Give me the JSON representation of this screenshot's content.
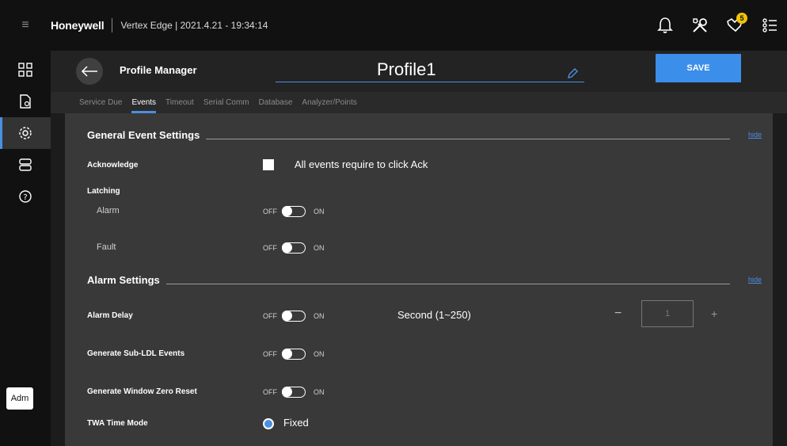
{
  "topbar": {
    "brand": "Honeywell",
    "subtitle": "Vertex Edge | 2021.4.21 - 19:34:14",
    "icons": [
      "menu-icon",
      "bell-icon",
      "tools-icon",
      "hands-icon",
      "list-icon"
    ],
    "badge_count": "5",
    "badge_color": "#f2c200"
  },
  "sidebar": {
    "items": [
      "dashboard-icon",
      "document-icon",
      "settings-icon",
      "storage-icon",
      "help-icon"
    ],
    "active": "settings-icon",
    "avatar_label": "Adm"
  },
  "header": {
    "title": "Profile Manager",
    "profile_name": "Profile1",
    "save_label": "SAVE",
    "accent": "#3b8eea"
  },
  "tabs": [
    {
      "label": "Service Due",
      "active": false
    },
    {
      "label": "Events",
      "active": true
    },
    {
      "label": "Timeout",
      "active": false
    },
    {
      "label": "Serial Comm",
      "active": false
    },
    {
      "label": "Database",
      "active": false
    },
    {
      "label": "Analyzer/Points",
      "active": false
    }
  ],
  "general": {
    "title": "General Event Settings",
    "hide": "hide",
    "acknowledge": {
      "label": "Acknowledge",
      "checkbox_label": "All events require to click Ack"
    },
    "latching": {
      "label": "Latching",
      "alarm": "Alarm",
      "fault": "Fault"
    }
  },
  "alarm": {
    "title": "Alarm Settings",
    "hide": "hide",
    "delay": {
      "label": "Alarm Delay",
      "unit_label": "Second (1~250)",
      "value": "1",
      "minus": "−",
      "plus": "+"
    },
    "sub_ldl": {
      "label": "Generate Sub-LDL Events"
    },
    "window_zero": {
      "label": "Generate Window Zero Reset"
    },
    "twa": {
      "label": "TWA Time Mode",
      "option": "Fixed"
    }
  },
  "toggle": {
    "off": "OFF",
    "on": "ON"
  }
}
